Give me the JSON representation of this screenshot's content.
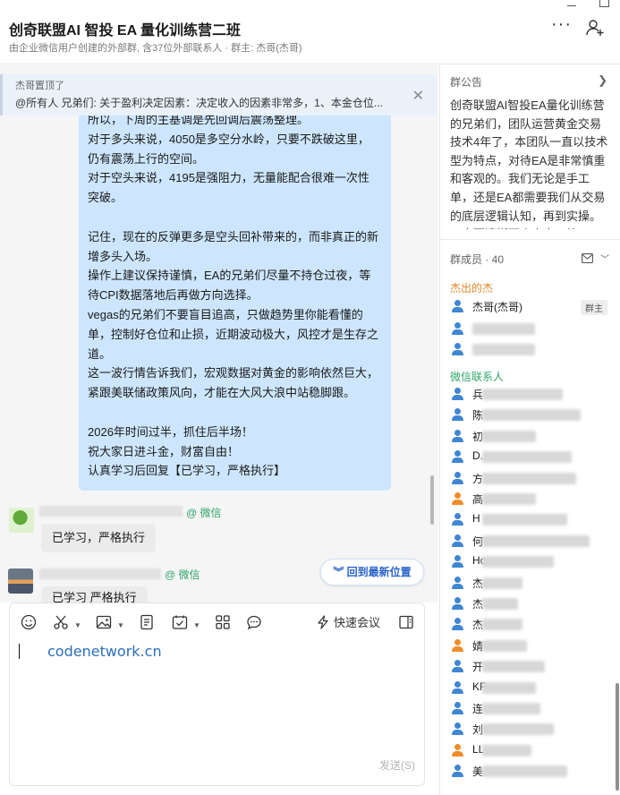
{
  "header": {
    "title": "创奇联盟AI 智投 EA 量化训练营二班",
    "subtitle": "由企业微信用户创建的外部群, 含37位外部联系人 · 群主: 杰哥(杰哥)"
  },
  "pinned": {
    "pinned_by": "杰哥置顶了",
    "text": "@所有人 兄弟们:  关于盈利决定因素：决定收入的因素非常多，1、本金仓位...",
    "close_icon": "close-icon"
  },
  "chat": {
    "long_message_lines": [
      "所以，下周的主基调是先回调后震荡整理。",
      "对于多头来说，4050是多空分水岭，只要不跌破这里，",
      "仍有震荡上行的空间。",
      "对于空头来说，4195是强阻力，无量能配合很难一次性",
      "突破。",
      "",
      "记住，现在的反弹更多是空头回补带来的，而非真正的新",
      "增多头入场。",
      "操作上建议保持谨慎，EA的兄弟们尽量不持仓过夜，等",
      "待CPI数据落地后再做方向选择。",
      "vegas的兄弟们不要盲目追高，只做趋势里你能看懂的",
      "单，控制好仓位和止损，近期波动极大，风控才是生存之",
      "道。",
      "这一波行情告诉我们，宏观数据对黄金的影响依然巨大，",
      "紧跟美联储政策风向，才能在大风大浪中站稳脚跟。",
      "",
      "2026年时间过半，抓住后半场！",
      "祝大家日进斗金，财富自由！",
      "认真学习后回复【已学习，严格执行】"
    ],
    "replies": [
      {
        "source": "@ 微信",
        "text": "已学习，严格执行"
      },
      {
        "source": "@ 微信",
        "text": "已学习 严格执行"
      }
    ],
    "jump_button": "回到最新位置"
  },
  "input": {
    "meeting_label": "快速会议",
    "typed_text": "codenetwork.cn",
    "send_label": "发送(S)"
  },
  "group_notice": {
    "title": "群公告",
    "text": "创奇联盟AI智投EA量化训练营的兄弟们，团队运营黄金交易技术4年了，本团队一直以技术型为特点，对待EA是非常慎重和客观的。我们无论是手工单，还是EA都需要我们从交易的底层逻辑认知，再到实操。一定要清晰两个事实，第一"
  },
  "members": {
    "title": "群成员 · 40",
    "group_owner_label": "杰出的杰",
    "owner": {
      "name": "杰哥(杰哥)",
      "badge": "群主"
    },
    "contacts_label": "微信联系人",
    "contacts": [
      {
        "prefix": "兵",
        "color": "blue"
      },
      {
        "prefix": "陈",
        "color": "blue"
      },
      {
        "prefix": "初",
        "color": "blue"
      },
      {
        "prefix": "D.",
        "color": "blue"
      },
      {
        "prefix": "方",
        "color": "blue"
      },
      {
        "prefix": "高",
        "color": "orange"
      },
      {
        "prefix": "H",
        "color": "blue"
      },
      {
        "prefix": "何",
        "color": "blue"
      },
      {
        "prefix": "Ho",
        "color": "blue"
      },
      {
        "prefix": "杰",
        "color": "blue"
      },
      {
        "prefix": "杰",
        "color": "blue"
      },
      {
        "prefix": "杰",
        "color": "blue"
      },
      {
        "prefix": "婧",
        "color": "orange"
      },
      {
        "prefix": "开",
        "color": "blue"
      },
      {
        "prefix": "KF",
        "color": "blue"
      },
      {
        "prefix": "连",
        "color": "blue"
      },
      {
        "prefix": "刘",
        "color": "blue"
      },
      {
        "prefix": "LL",
        "color": "orange"
      },
      {
        "prefix": "美",
        "color": "blue"
      }
    ]
  },
  "colors": {
    "accent_blue": "#2a62c9",
    "bubble_self": "#cde6fd",
    "wechat_green": "#2fa56a",
    "group_orange": "#e0862a"
  }
}
